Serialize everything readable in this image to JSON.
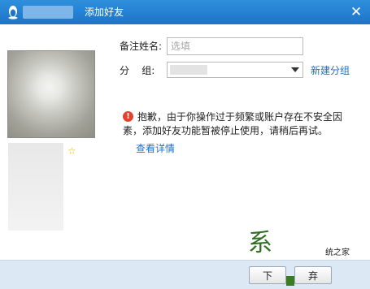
{
  "window": {
    "title": "添加好友",
    "close_symbol": "✕",
    "logo_icon": "qq-penguin-icon"
  },
  "form": {
    "remark_label": "备注姓名:",
    "remark_placeholder": "选填",
    "group_label": "分    组:",
    "new_group_link": "新建分组"
  },
  "profile": {
    "star_symbol": "☆"
  },
  "error": {
    "icon_symbol": "!",
    "line1": "抱歉，由于你操作过于频繁或账户存在不安全因",
    "line2": "素，添加好友功能暂被停止使用，请稍后再试。",
    "details_link": "查看详情"
  },
  "footer": {
    "left_button_label": "下",
    "right_button_label": "弃"
  },
  "watermark": {
    "glyph": "系",
    "text": "统之家"
  },
  "colors": {
    "titlebar": "#1d74c8",
    "link": "#1a6fc4",
    "error_icon": "#e3422e",
    "footer": "#dce8f4",
    "star": "#f0b400"
  }
}
